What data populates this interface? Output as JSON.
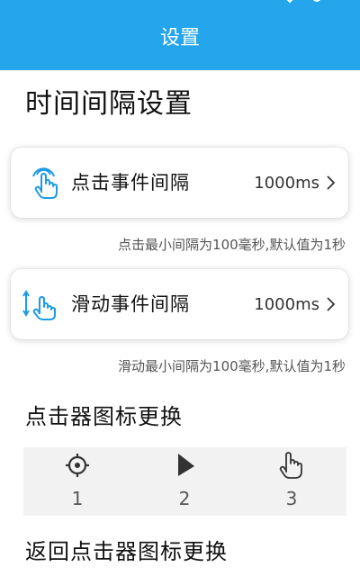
{
  "app_bar": {
    "title": "设置",
    "background": "#25a5ec"
  },
  "interval_section": {
    "title": "时间间隔设置",
    "click_card": {
      "icon": "tap-hand-icon",
      "label": "点击事件间隔",
      "value": "1000ms",
      "hint": "点击最小间隔为100毫秒,默认值为1秒"
    },
    "swipe_card": {
      "icon": "swipe-hand-icon",
      "label": "滑动事件间隔",
      "value": "1000ms",
      "hint": "滑动最小间隔为100毫秒,默认值为1秒"
    }
  },
  "clicker_icon_section": {
    "title": "点击器图标更换",
    "options": [
      {
        "icon": "crosshair-icon",
        "number": "1"
      },
      {
        "icon": "arrow-pointer-icon",
        "number": "2"
      },
      {
        "icon": "pointing-hand-icon",
        "number": "3"
      }
    ]
  },
  "partial_section": {
    "title": "返回点击器图标更换"
  },
  "colors": {
    "accent": "#25a5ec",
    "icon_blue": "#1e9be6"
  }
}
